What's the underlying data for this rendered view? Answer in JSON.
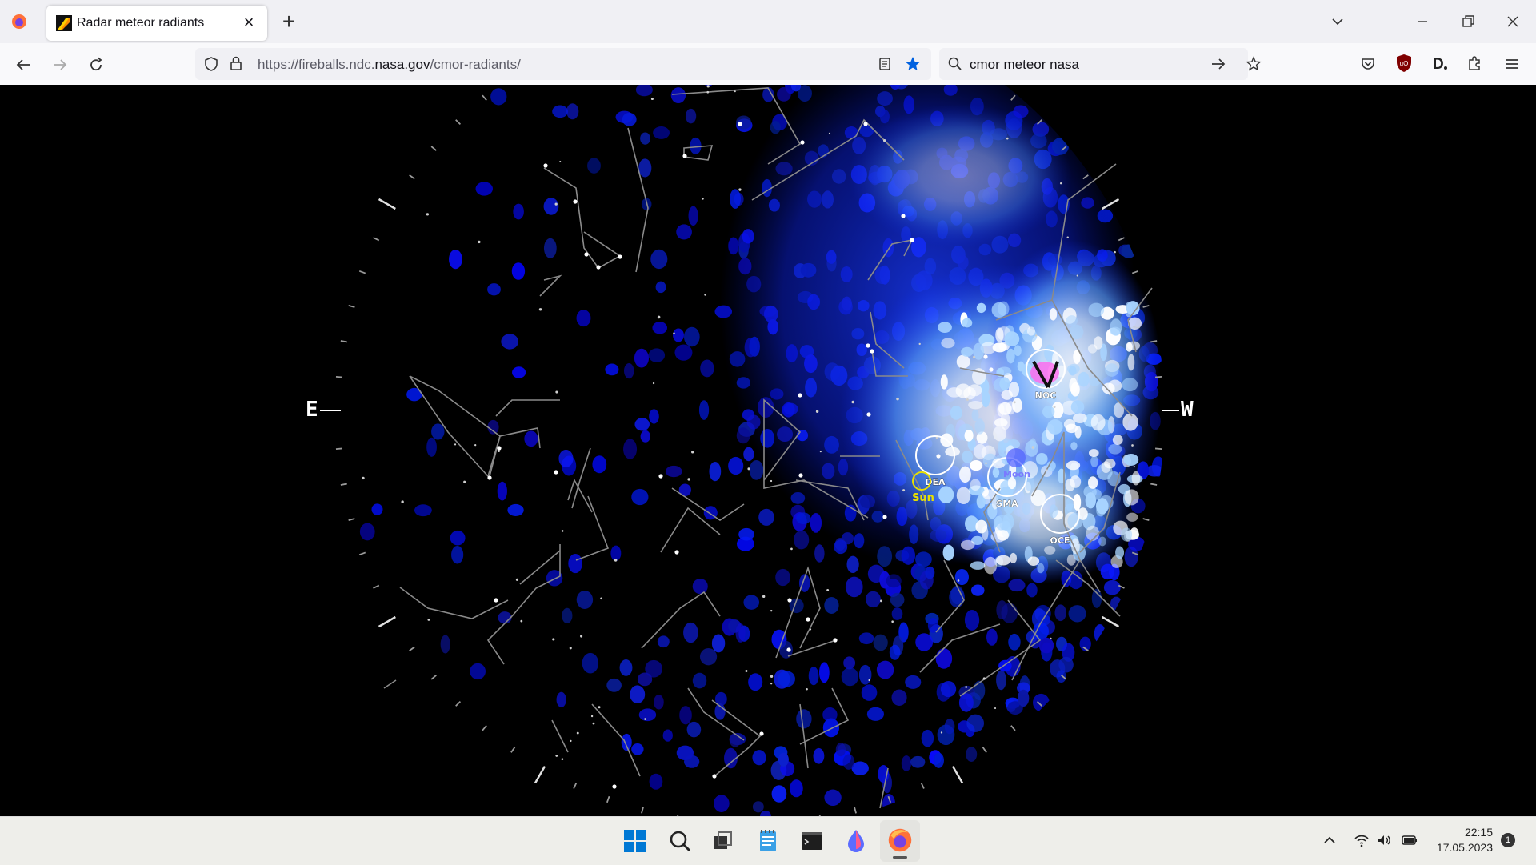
{
  "browser": {
    "tab_title": "Radar meteor radiants",
    "url_prefix": "https://fireballs.ndc.",
    "url_domain": "nasa.gov",
    "url_path": "/cmor-radiants/",
    "search_query": "cmor meteor nasa",
    "icons": [
      "firefox-icon",
      "close-icon",
      "plus-icon",
      "chevron-down-icon",
      "minimize-icon",
      "restore-icon",
      "back-arrow-icon",
      "forward-arrow-icon",
      "reload-icon",
      "shield-icon",
      "lock-icon",
      "reader-view-icon",
      "star-icon",
      "search-icon",
      "arrow-right-icon",
      "extension-pin-icon",
      "pocket-icon",
      "ublock-icon",
      "d-icon",
      "puzzle-icon",
      "menu-icon"
    ]
  },
  "skymap": {
    "compass_east": "E",
    "compass_west": "W",
    "radiants": [
      {
        "code": "NOC"
      },
      {
        "code": "DEA"
      },
      {
        "code": "SMA"
      },
      {
        "code": "OCE"
      }
    ],
    "sun_label": "Sun",
    "moon_label": "Moon",
    "colors": {
      "background": "#000000",
      "density_low": "#0a14c8",
      "density_high": "#ffffff",
      "sun": "#e8e000",
      "moon": "#7a7aff",
      "constellation": "#9a9a9a"
    }
  },
  "taskbar": {
    "time": "22:15",
    "date": "17.05.2023",
    "notification_count": "1",
    "icons": [
      "windows-start-icon",
      "search-icon",
      "task-view-icon",
      "notepad-icon",
      "terminal-icon",
      "app-drop-icon",
      "firefox-icon",
      "chevron-up-icon",
      "wifi-icon",
      "volume-icon",
      "battery-icon"
    ]
  }
}
